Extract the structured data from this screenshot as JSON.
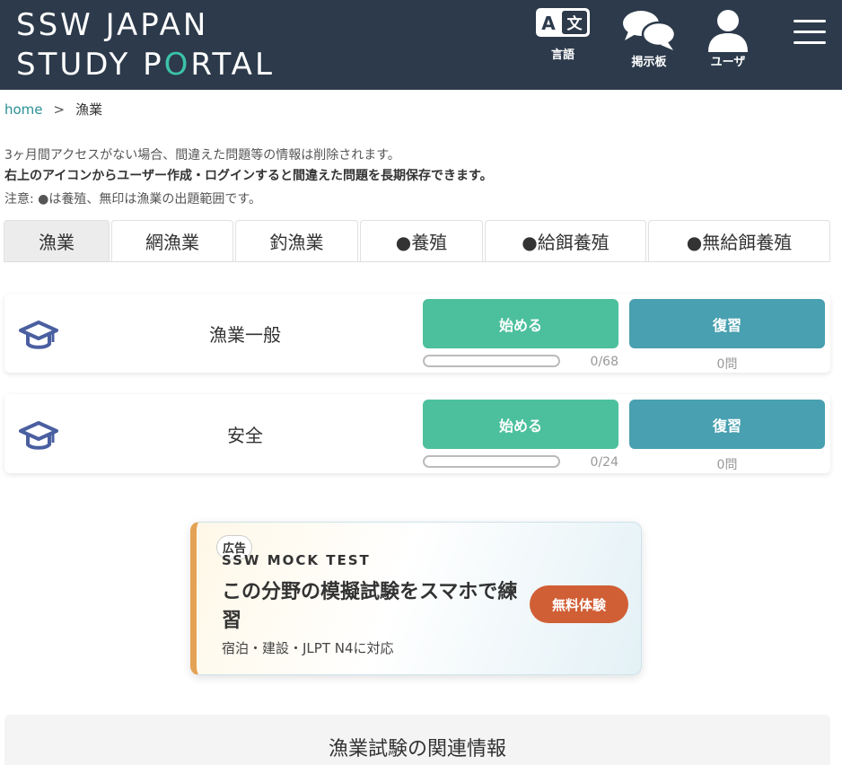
{
  "header": {
    "logo_line1": "SSW JAPAN",
    "logo_line2_a": "STUDY P",
    "logo_line2_o": "O",
    "logo_line2_b": "RTAL",
    "nav": [
      {
        "label": "言語",
        "icon": "language-icon"
      },
      {
        "label": "掲示板",
        "icon": "chat-bubbles-icon"
      },
      {
        "label": "ユーザ",
        "icon": "user-icon"
      }
    ],
    "menu_icon": "hamburger-menu-icon"
  },
  "breadcrumb": {
    "home": "home",
    "separator": ">",
    "current": "漁業"
  },
  "notes": {
    "line1": "3ヶ月間アクセスがない場合、間違えた問題等の情報は削除されます。",
    "line2": "右上のアイコンからユーザー作成・ログインすると間違えた問題を長期保存できます。",
    "line3": "注意: ●は養殖、無印は漁業の出題範囲です。"
  },
  "tabs": [
    {
      "label": "漁業",
      "active": true
    },
    {
      "label": "網漁業",
      "active": false
    },
    {
      "label": "釣漁業",
      "active": false
    },
    {
      "label": "●養殖",
      "active": false
    },
    {
      "label": "●給餌養殖",
      "active": false
    },
    {
      "label": "●無給餌養殖",
      "active": false
    }
  ],
  "categories": [
    {
      "title": "漁業一般",
      "start_label": "始める",
      "review_label": "復習",
      "progress_text": "0/68",
      "progress_fraction": 0,
      "review_count": "0問",
      "icon": "graduation-cap-icon"
    },
    {
      "title": "安全",
      "start_label": "始める",
      "review_label": "復習",
      "progress_text": "0/24",
      "progress_fraction": 0,
      "review_count": "0問",
      "icon": "graduation-cap-icon"
    }
  ],
  "ad": {
    "badge": "広告",
    "subtitle": "SSW MOCK TEST",
    "headline": "この分野の模擬試験をスマホで練習",
    "description": "宿泊・建設・JLPT N4に対応",
    "cta": "無料体験"
  },
  "related": {
    "title": "漁業試験の関連情報"
  },
  "colors": {
    "header_bg": "#2c3a4b",
    "logo_accent": "#3cc3a8",
    "start_button": "#4cc09c",
    "review_button": "#48a0b0",
    "cap_icon": "#4a5fa0",
    "ad_cta": "#d15f36",
    "ad_border": "#e4a254"
  }
}
